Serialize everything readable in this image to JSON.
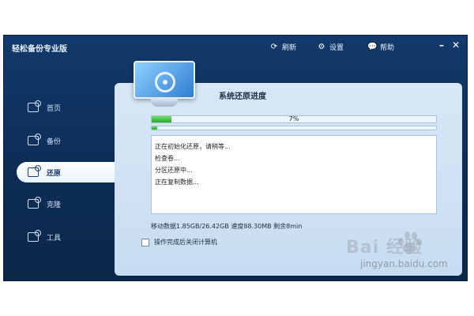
{
  "app": {
    "title": "轻松备份专业版"
  },
  "toolbar": {
    "refresh_label": "刷新",
    "settings_label": "设置",
    "help_label": "帮助",
    "refresh_icon": "refresh-icon",
    "settings_icon": "gear-icon",
    "help_icon": "chat-bubble-icon"
  },
  "sidebar": {
    "items": [
      {
        "label": "首页",
        "icon": "home-icon",
        "active": false
      },
      {
        "label": "备份",
        "icon": "backup-icon",
        "active": false
      },
      {
        "label": "还原",
        "icon": "restore-icon",
        "active": true
      },
      {
        "label": "克隆",
        "icon": "clone-icon",
        "active": false
      },
      {
        "label": "工具",
        "icon": "tools-icon",
        "active": false
      }
    ]
  },
  "main": {
    "title": "系统还原进度",
    "progress_percent_text": "7%",
    "progress_fraction": 0.07,
    "secondary_progress_fraction": 0.02,
    "log": [
      "正在初始化还原，请稍等...",
      "检查卷...",
      "分区还原中...",
      "正在复制数据..."
    ],
    "status": "移动数据1.85GB/26.42GB  速度88.30MB  剩余8min",
    "checkbox_label": "操作完成后关闭计算机",
    "checkbox_checked": false
  },
  "watermark": {
    "logo_text": "Bai 经验",
    "url": "jingyan.baidu.com"
  },
  "colors": {
    "window_bg": "#123a6c",
    "panel_bg": "#d7e7f6",
    "progress_green": "#2ea82a"
  }
}
